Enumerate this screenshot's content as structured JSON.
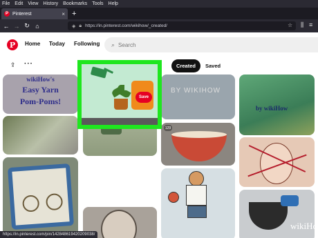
{
  "menubar": [
    "File",
    "Edit",
    "View",
    "History",
    "Bookmarks",
    "Tools",
    "Help"
  ],
  "tab": {
    "title": "Pinterest",
    "close": "×",
    "new_tab": "+"
  },
  "address": {
    "url": "https://in.pinterest.com/wikihow/_created/"
  },
  "header": {
    "logo": "P",
    "nav": [
      "Home",
      "Today",
      "Following"
    ],
    "search_placeholder": "Search"
  },
  "profile_bar": {
    "created": "Created",
    "saved": "Saved"
  },
  "pins": {
    "yarn_line1": "wikiHow's",
    "yarn_line2": "Easy Yarn",
    "yarn_line3": "Pom-Poms!",
    "save_label": "Save",
    "bywikihow_faded": "BY WIKIHOW",
    "repin_count": "129",
    "bywikihow": "by wikiHow",
    "watermark": "wikiHow"
  },
  "status": {
    "url": "https://in.pinterest.com/pin/142848619420209038/"
  }
}
